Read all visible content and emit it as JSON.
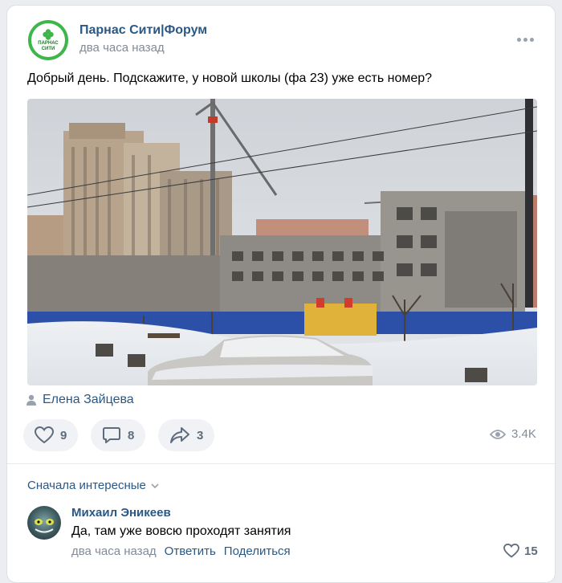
{
  "post": {
    "group_name": "Парнас Сити|Форум",
    "avatar_text": "ПАРНАС СИТИ",
    "time": "два часа назад",
    "text": "Добрый день. Подскажите, у новой школы (фа 23) уже есть номер?",
    "author": "Елена Зайцева",
    "likes": "9",
    "comments": "8",
    "shares": "3",
    "views": "3.4K"
  },
  "comments_section": {
    "sort_label": "Сначала интересные",
    "items": [
      {
        "author": "Михаил Эникеев",
        "text": "Да, там уже вовсю проходят занятия",
        "time": "два часа назад",
        "reply": "Ответить",
        "share": "Поделиться",
        "likes": "15"
      }
    ]
  },
  "colors": {
    "link": "#2a5885",
    "secondary": "#818c99",
    "icon": "#5e6c7c",
    "brand_green": "#3fb64a"
  }
}
